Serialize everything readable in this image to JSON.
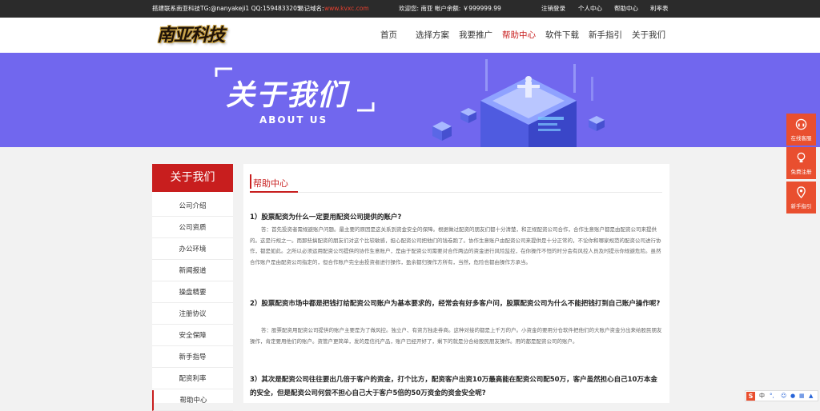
{
  "topbar": {
    "contact": "搭建联系南亚科技TG:@nanyakeji1 QQ:1594833205",
    "domain_label": "易记域名:",
    "domain": "www.kvxc.com",
    "welcome": "欢迎您: 南亚 帐户余额: ￥999999.99",
    "logout": "注销登录",
    "personal": "个人中心",
    "help": "帮助中心",
    "rate": "利率表"
  },
  "logo": {
    "text": "南亚科技"
  },
  "nav": [
    "首页",
    "选择方案",
    "我要推广",
    "帮助中心",
    "软件下载",
    "新手指引",
    "关于我们"
  ],
  "banner": {
    "title": "关于我们",
    "subtitle": "ABOUT US"
  },
  "sidebar": {
    "title": "关于我们",
    "items": [
      "公司介绍",
      "公司资质",
      "办公环境",
      "新闻报道",
      "操盘精要",
      "注册协议",
      "安全保障",
      "新手指导",
      "配资利率",
      "帮助中心"
    ]
  },
  "content": {
    "title": "帮助中心",
    "qas": [
      {
        "q": "1）股票配资为什么一定要用配资公司提供的账户?",
        "a": "答：首先投资者需规避账户问题。最主要的原因是这关系到资金安全的保障。根据做过配资的朋友们都十分清楚，和正规配资公司合作，合作生意账户都是由配资公司来提供的。这是行规之一。而那些搞配资的朋友们对这个比较敏感，担心配资公司把他们的钱卷跑了。协作生意账户由配资公司来提供是十分正常的，不论你和哪家规范的配资公司进行协作，都是如此。之所以必须运用配资公司提供的协作生意账户，是由于配资公司需要对合作两边的资金进行风险监控，在你操作不恒的时分会有风控人员及时提示你规避危险。虽然合作账户是由配资公司指定的，但合作账户完全由投资者进行操作，盈余都归操作方所有，当然，危险也都由操作方承当。"
      },
      {
        "q": "2）股票配资市场中都是把钱打给配资公司账户为基本要求的，经常会有好多客户问，股票配资公司为什么不能把钱打到自己账户操作呢?",
        "a": "答：股票配资用配资公司提供的账户主要是为了做风控。独立户、有资方独走券商。这种对接的都是上千万的户。小资金的要用分仓软件把他们的大账户资金分出来给股民朋友操作，肯定要用他们的账户。资管户更简单，发的是信托产品，账户已经开好了，剩下的就是分合给股民朋友操作。用的都是配资公司的账户。"
      },
      {
        "q": "3）其次是配资公司往往要出几倍于客户的资金，打个比方，配资客户出资10万最高能在配资公司配50万，客户虽然担心自己10万本金的安全，但是配资公司何尝不担心自己大于客户5倍的50万资金的资金安全呢?",
        "a": ""
      }
    ]
  },
  "floats": [
    "在线客服",
    "免费注册",
    "新手指引"
  ],
  "ime": {
    "lang": "中"
  },
  "colors": {
    "accent": "#c81e1e",
    "banner": "#7167ee",
    "float": "#e94f2f",
    "topbar": "#2b2b2b"
  }
}
